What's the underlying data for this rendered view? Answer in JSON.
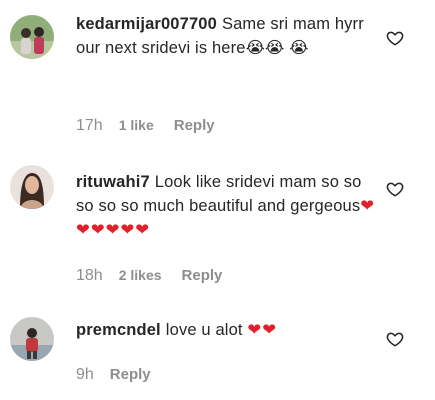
{
  "comments": [
    {
      "username": "kedarmijar007700",
      "text": "Same sri mam hyrr our next sridevi is here",
      "emojis": [
        "😭",
        "😭",
        "😭"
      ],
      "time": "17h",
      "likes": "1 like",
      "reply": "Reply"
    },
    {
      "username": "rituwahi7",
      "text": "Look like sridevi mam so so so so so much beautiful and gergeous",
      "hearts": "❤❤❤❤❤❤",
      "time": "18h",
      "likes": "2 likes",
      "reply": "Reply"
    },
    {
      "username": "premcndel",
      "text": "love u alot",
      "hearts": "❤❤",
      "time": "9h",
      "reply": "Reply"
    }
  ]
}
